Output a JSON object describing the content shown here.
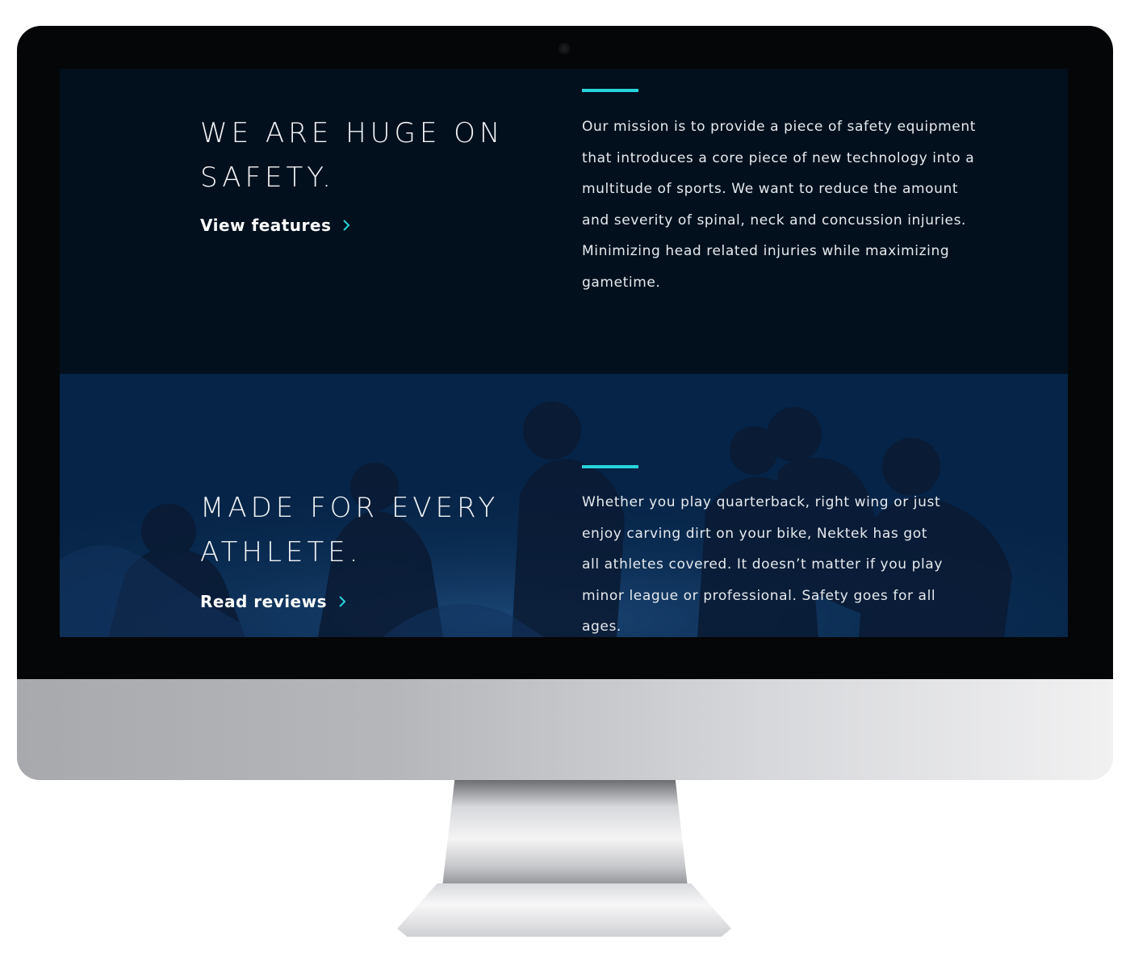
{
  "colors": {
    "accent": "#27d4dc",
    "section_dark": "#02101d",
    "section_blue": "#062447",
    "text": "#ffffff"
  },
  "safety_section": {
    "heading": "WE ARE HUGE ON SAFETY.",
    "link_label": "View features",
    "link_icon": "chevron-right-icon",
    "body": "Our mission is to provide a piece of safety equipment that introduces a core piece of new technology into a multitude of sports. We want to reduce the amount and severity of spinal, neck and concussion injuries. Minimizing head related injuries while maximizing gametime."
  },
  "athlete_section": {
    "heading": "MADE FOR EVERY ATHLETE.",
    "link_label": "Read reviews",
    "link_icon": "chevron-right-icon",
    "body": "Whether you play quarterback, right wing or just enjoy carving dirt on your bike, Nektek has got all athletes covered. It doesn’t matter if you play minor league or professional. Safety goes for all ages."
  }
}
